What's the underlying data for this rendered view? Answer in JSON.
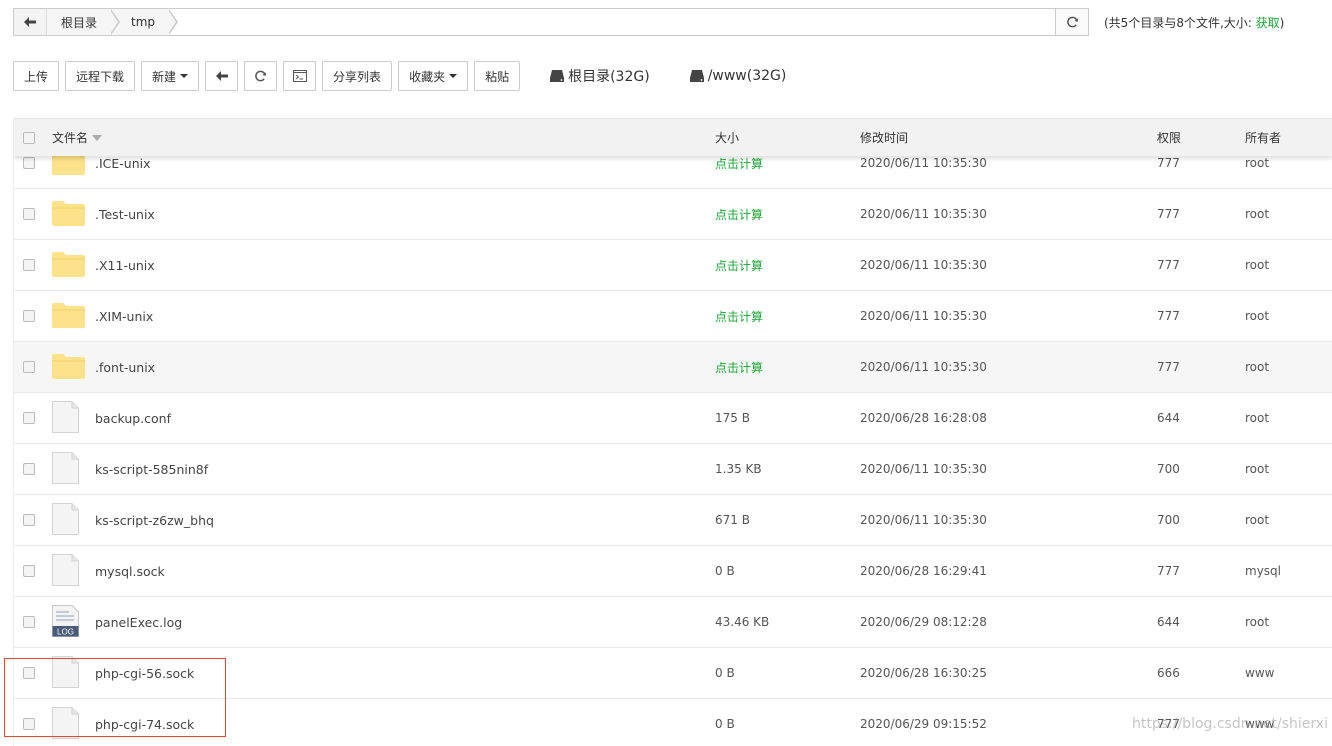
{
  "path": {
    "crumbs": [
      "根目录",
      "tmp"
    ]
  },
  "summary": {
    "text": "(共5个目录与8个文件,大小: ",
    "get_label": "获取",
    "close": ")"
  },
  "toolbar": {
    "upload": "上传",
    "remote_download": "远程下载",
    "new": "新建",
    "share_list": "分享列表",
    "favorites": "收藏夹",
    "paste": "粘贴",
    "disks": [
      "根目录(32G)",
      "/www(32G)"
    ]
  },
  "table": {
    "headers": {
      "name": "文件名",
      "size": "大小",
      "mtime": "修改时间",
      "perm": "权限",
      "owner": "所有者"
    },
    "rows": [
      {
        "type": "folder",
        "name": ".ICE-unix",
        "size": "点击计算",
        "mtime": "2020/06/11 10:35:30",
        "perm": "777",
        "owner": "root"
      },
      {
        "type": "folder",
        "name": ".Test-unix",
        "size": "点击计算",
        "mtime": "2020/06/11 10:35:30",
        "perm": "777",
        "owner": "root"
      },
      {
        "type": "folder",
        "name": ".X11-unix",
        "size": "点击计算",
        "mtime": "2020/06/11 10:35:30",
        "perm": "777",
        "owner": "root"
      },
      {
        "type": "folder",
        "name": ".XIM-unix",
        "size": "点击计算",
        "mtime": "2020/06/11 10:35:30",
        "perm": "777",
        "owner": "root"
      },
      {
        "type": "folder",
        "name": ".font-unix",
        "size": "点击计算",
        "mtime": "2020/06/11 10:35:30",
        "perm": "777",
        "owner": "root"
      },
      {
        "type": "file",
        "name": "backup.conf",
        "size": "175 B",
        "mtime": "2020/06/28 16:28:08",
        "perm": "644",
        "owner": "root"
      },
      {
        "type": "file",
        "name": "ks-script-585nin8f",
        "size": "1.35 KB",
        "mtime": "2020/06/11 10:35:30",
        "perm": "700",
        "owner": "root"
      },
      {
        "type": "file",
        "name": "ks-script-z6zw_bhq",
        "size": "671 B",
        "mtime": "2020/06/11 10:35:30",
        "perm": "700",
        "owner": "root"
      },
      {
        "type": "file",
        "name": "mysql.sock",
        "size": "0 B",
        "mtime": "2020/06/28 16:29:41",
        "perm": "777",
        "owner": "mysql"
      },
      {
        "type": "log",
        "name": "panelExec.log",
        "size": "43.46 KB",
        "mtime": "2020/06/29 08:12:28",
        "perm": "644",
        "owner": "root"
      },
      {
        "type": "file",
        "name": "php-cgi-56.sock",
        "size": "0 B",
        "mtime": "2020/06/28 16:30:25",
        "perm": "666",
        "owner": "www"
      },
      {
        "type": "file",
        "name": "php-cgi-74.sock",
        "size": "0 B",
        "mtime": "2020/06/29 09:15:52",
        "perm": "777",
        "owner": "www"
      }
    ],
    "log_badge": "LOG"
  },
  "watermark": "https://blog.csdn.net/shierxi",
  "colors": {
    "accent": "#20a53a",
    "folder": "#fce28a",
    "highlight": "#e43"
  }
}
